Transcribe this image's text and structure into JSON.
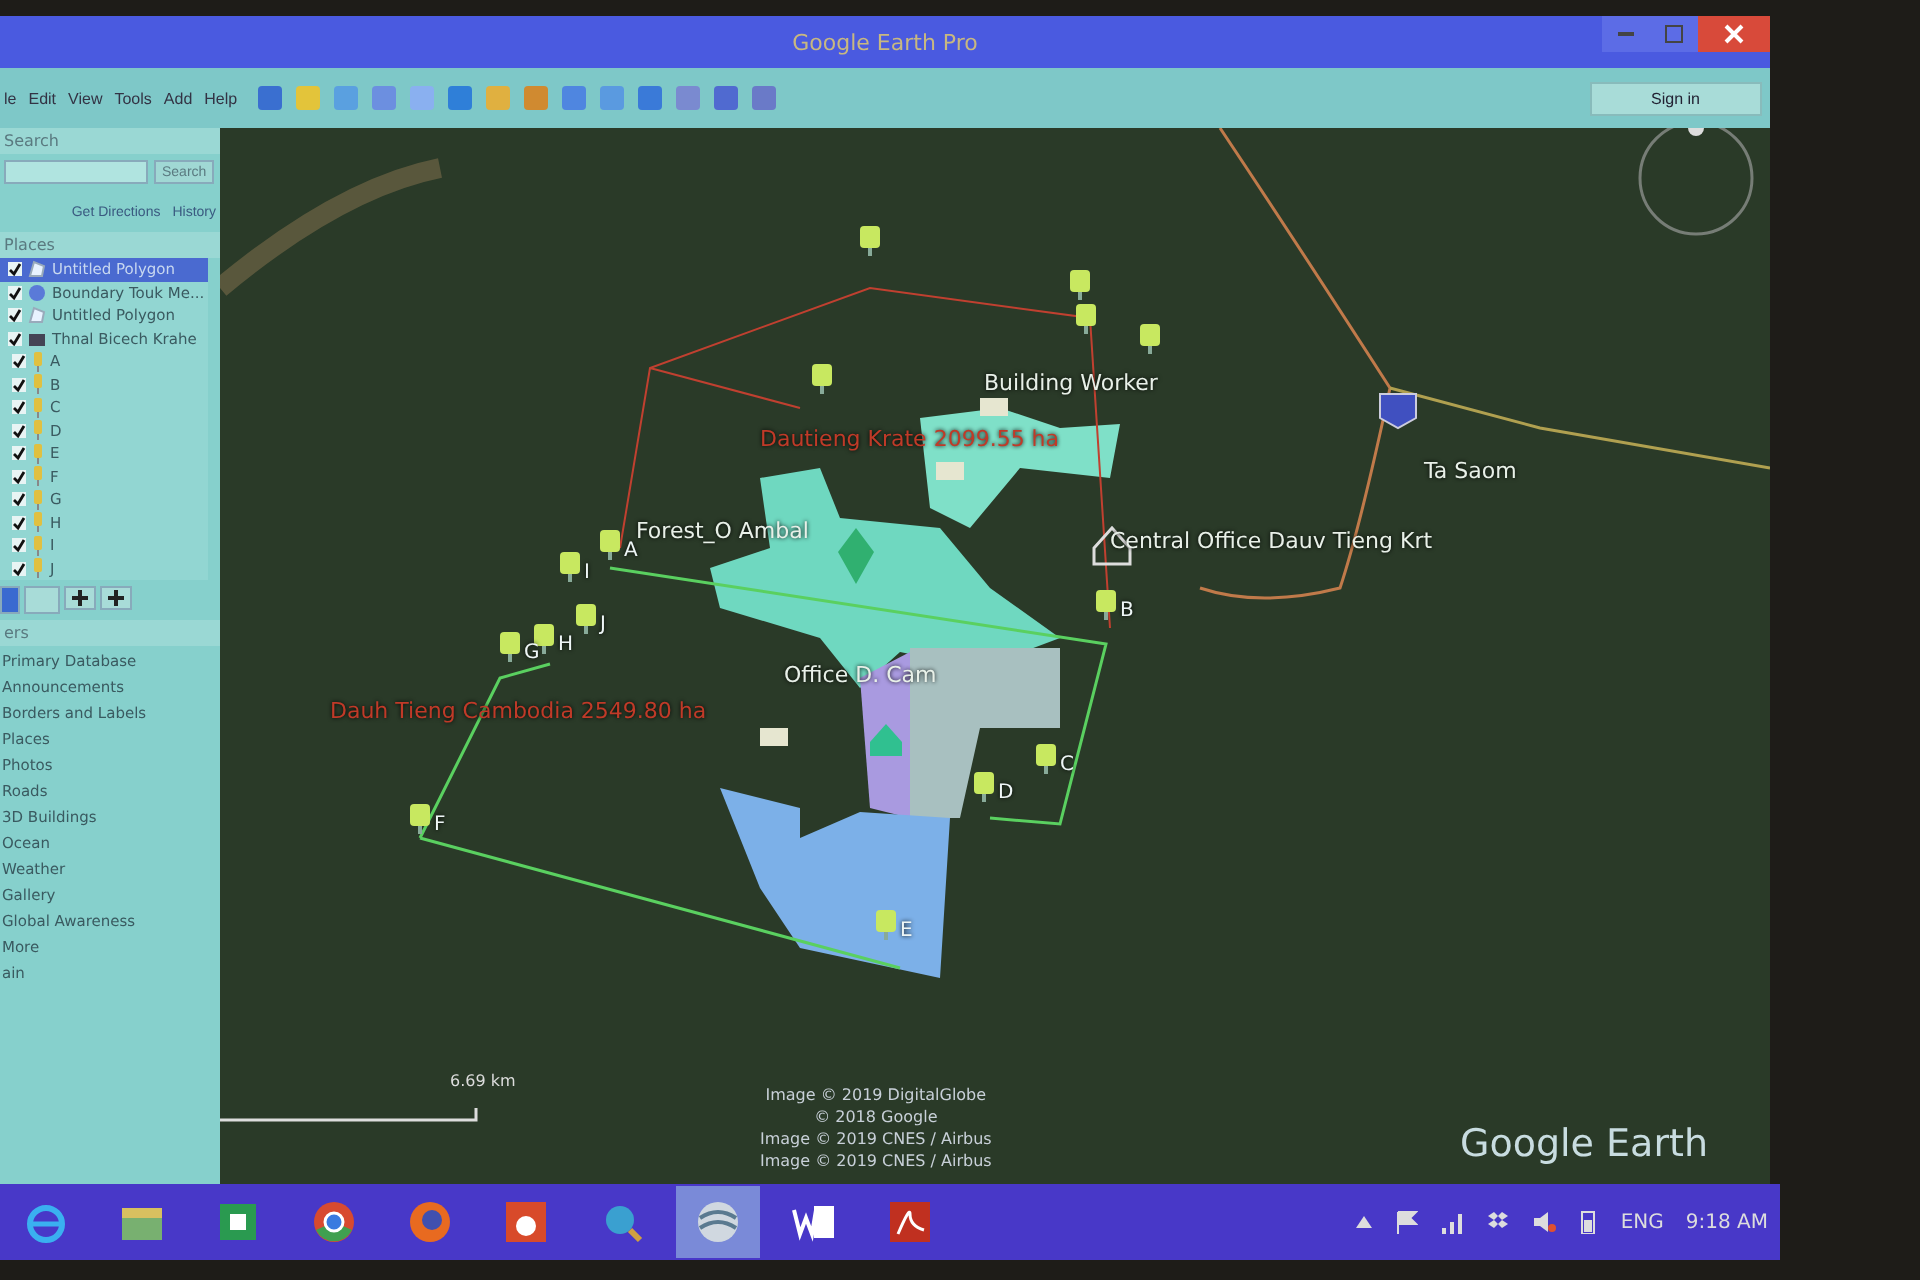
{
  "window": {
    "title": "Google Earth Pro",
    "sign_in": "Sign in"
  },
  "menu": [
    "le",
    "Edit",
    "View",
    "Tools",
    "Add",
    "Help"
  ],
  "sidebar": {
    "search_header": "Search",
    "search_button": "Search",
    "links": [
      "Get Directions",
      "History"
    ],
    "places_header": "Places",
    "places": [
      {
        "label": "Untitled Polygon",
        "checked": true,
        "selected": true,
        "kind": "polygon"
      },
      {
        "label": "Boundary Touk Me...",
        "checked": true,
        "selected": false,
        "kind": "globe"
      },
      {
        "label": "Untitled Polygon",
        "checked": true,
        "selected": false,
        "kind": "polygon"
      },
      {
        "label": "Thnal Bicech Krahe",
        "checked": true,
        "selected": false,
        "kind": "folder",
        "children": [
          {
            "label": "A",
            "checked": true
          },
          {
            "label": "B",
            "checked": true
          },
          {
            "label": "C",
            "checked": true
          },
          {
            "label": "D",
            "checked": true
          },
          {
            "label": "E",
            "checked": true
          },
          {
            "label": "F",
            "checked": true
          },
          {
            "label": "G",
            "checked": true
          },
          {
            "label": "H",
            "checked": true
          },
          {
            "label": "I",
            "checked": true
          },
          {
            "label": "J",
            "checked": true
          }
        ]
      }
    ],
    "layers_header": "ers",
    "layers": [
      "Primary Database",
      "Announcements",
      "Borders and Labels",
      "Places",
      "Photos",
      "Roads",
      "3D Buildings",
      "Ocean",
      "Weather",
      "Gallery",
      "Global Awareness",
      "More",
      "ain"
    ]
  },
  "map": {
    "labels": [
      {
        "text": "Building Worker",
        "kind": "place"
      },
      {
        "text": "Dautieng Krate 2099.55 ha",
        "kind": "area"
      },
      {
        "text": "Forest_O Ambal",
        "kind": "place"
      },
      {
        "text": "Ta Saom",
        "kind": "place"
      },
      {
        "text": "Central Office Dauv Tieng Krt",
        "kind": "place"
      },
      {
        "text": "Office D. Cam",
        "kind": "place"
      },
      {
        "text": "Dauh Tieng Cambodia 2549.80 ha",
        "kind": "area"
      }
    ],
    "pins": [
      "A",
      "B",
      "C",
      "D",
      "E",
      "F",
      "G",
      "H",
      "I",
      "J"
    ],
    "scale": "6.69 km",
    "credits": [
      "Image © 2019 DigitalGlobe",
      "© 2018 Google",
      "Image © 2019 CNES / Airbus",
      "Image © 2019 CNES / Airbus"
    ],
    "logo": "Google Earth"
  },
  "taskbar": {
    "apps": [
      {
        "kind": "ie",
        "selected": false
      },
      {
        "kind": "folder",
        "selected": false
      },
      {
        "kind": "store",
        "selected": false
      },
      {
        "kind": "chrome",
        "selected": false
      },
      {
        "kind": "firefox",
        "selected": false
      },
      {
        "kind": "media",
        "selected": false
      },
      {
        "kind": "search",
        "selected": false
      },
      {
        "kind": "earth",
        "selected": true
      },
      {
        "kind": "word",
        "selected": false
      },
      {
        "kind": "acrobat",
        "selected": false
      }
    ],
    "language": "ENG",
    "time": "9:18 AM"
  }
}
